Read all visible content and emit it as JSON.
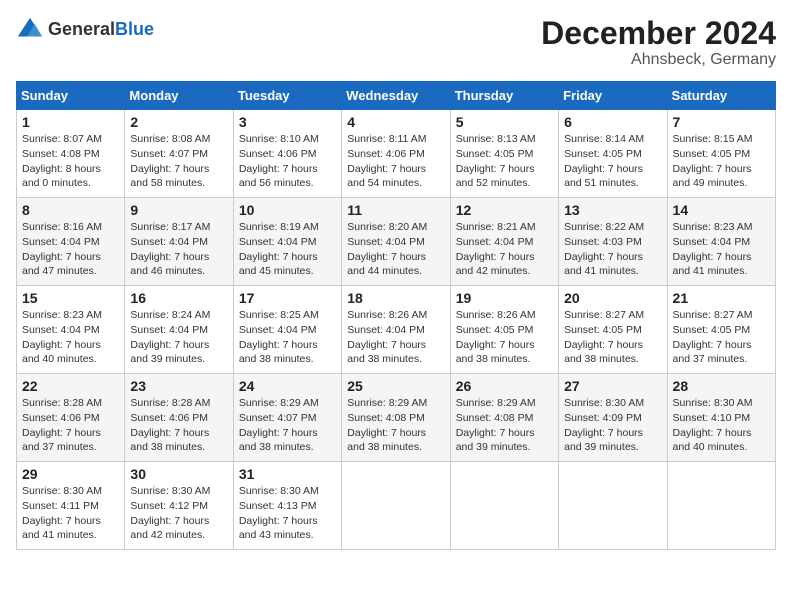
{
  "header": {
    "logo_general": "General",
    "logo_blue": "Blue",
    "month_title": "December 2024",
    "location": "Ahnsbeck, Germany"
  },
  "days_of_week": [
    "Sunday",
    "Monday",
    "Tuesday",
    "Wednesday",
    "Thursday",
    "Friday",
    "Saturday"
  ],
  "weeks": [
    [
      {
        "day": "1",
        "sunrise": "8:07 AM",
        "sunset": "4:08 PM",
        "daylight": "8 hours and 0 minutes."
      },
      {
        "day": "2",
        "sunrise": "8:08 AM",
        "sunset": "4:07 PM",
        "daylight": "7 hours and 58 minutes."
      },
      {
        "day": "3",
        "sunrise": "8:10 AM",
        "sunset": "4:06 PM",
        "daylight": "7 hours and 56 minutes."
      },
      {
        "day": "4",
        "sunrise": "8:11 AM",
        "sunset": "4:06 PM",
        "daylight": "7 hours and 54 minutes."
      },
      {
        "day": "5",
        "sunrise": "8:13 AM",
        "sunset": "4:05 PM",
        "daylight": "7 hours and 52 minutes."
      },
      {
        "day": "6",
        "sunrise": "8:14 AM",
        "sunset": "4:05 PM",
        "daylight": "7 hours and 51 minutes."
      },
      {
        "day": "7",
        "sunrise": "8:15 AM",
        "sunset": "4:05 PM",
        "daylight": "7 hours and 49 minutes."
      }
    ],
    [
      {
        "day": "8",
        "sunrise": "8:16 AM",
        "sunset": "4:04 PM",
        "daylight": "7 hours and 47 minutes."
      },
      {
        "day": "9",
        "sunrise": "8:17 AM",
        "sunset": "4:04 PM",
        "daylight": "7 hours and 46 minutes."
      },
      {
        "day": "10",
        "sunrise": "8:19 AM",
        "sunset": "4:04 PM",
        "daylight": "7 hours and 45 minutes."
      },
      {
        "day": "11",
        "sunrise": "8:20 AM",
        "sunset": "4:04 PM",
        "daylight": "7 hours and 44 minutes."
      },
      {
        "day": "12",
        "sunrise": "8:21 AM",
        "sunset": "4:04 PM",
        "daylight": "7 hours and 42 minutes."
      },
      {
        "day": "13",
        "sunrise": "8:22 AM",
        "sunset": "4:03 PM",
        "daylight": "7 hours and 41 minutes."
      },
      {
        "day": "14",
        "sunrise": "8:23 AM",
        "sunset": "4:04 PM",
        "daylight": "7 hours and 41 minutes."
      }
    ],
    [
      {
        "day": "15",
        "sunrise": "8:23 AM",
        "sunset": "4:04 PM",
        "daylight": "7 hours and 40 minutes."
      },
      {
        "day": "16",
        "sunrise": "8:24 AM",
        "sunset": "4:04 PM",
        "daylight": "7 hours and 39 minutes."
      },
      {
        "day": "17",
        "sunrise": "8:25 AM",
        "sunset": "4:04 PM",
        "daylight": "7 hours and 38 minutes."
      },
      {
        "day": "18",
        "sunrise": "8:26 AM",
        "sunset": "4:04 PM",
        "daylight": "7 hours and 38 minutes."
      },
      {
        "day": "19",
        "sunrise": "8:26 AM",
        "sunset": "4:05 PM",
        "daylight": "7 hours and 38 minutes."
      },
      {
        "day": "20",
        "sunrise": "8:27 AM",
        "sunset": "4:05 PM",
        "daylight": "7 hours and 38 minutes."
      },
      {
        "day": "21",
        "sunrise": "8:27 AM",
        "sunset": "4:05 PM",
        "daylight": "7 hours and 37 minutes."
      }
    ],
    [
      {
        "day": "22",
        "sunrise": "8:28 AM",
        "sunset": "4:06 PM",
        "daylight": "7 hours and 37 minutes."
      },
      {
        "day": "23",
        "sunrise": "8:28 AM",
        "sunset": "4:06 PM",
        "daylight": "7 hours and 38 minutes."
      },
      {
        "day": "24",
        "sunrise": "8:29 AM",
        "sunset": "4:07 PM",
        "daylight": "7 hours and 38 minutes."
      },
      {
        "day": "25",
        "sunrise": "8:29 AM",
        "sunset": "4:08 PM",
        "daylight": "7 hours and 38 minutes."
      },
      {
        "day": "26",
        "sunrise": "8:29 AM",
        "sunset": "4:08 PM",
        "daylight": "7 hours and 39 minutes."
      },
      {
        "day": "27",
        "sunrise": "8:30 AM",
        "sunset": "4:09 PM",
        "daylight": "7 hours and 39 minutes."
      },
      {
        "day": "28",
        "sunrise": "8:30 AM",
        "sunset": "4:10 PM",
        "daylight": "7 hours and 40 minutes."
      }
    ],
    [
      {
        "day": "29",
        "sunrise": "8:30 AM",
        "sunset": "4:11 PM",
        "daylight": "7 hours and 41 minutes."
      },
      {
        "day": "30",
        "sunrise": "8:30 AM",
        "sunset": "4:12 PM",
        "daylight": "7 hours and 42 minutes."
      },
      {
        "day": "31",
        "sunrise": "8:30 AM",
        "sunset": "4:13 PM",
        "daylight": "7 hours and 43 minutes."
      },
      null,
      null,
      null,
      null
    ]
  ],
  "labels": {
    "sunrise": "Sunrise: ",
    "sunset": "Sunset: ",
    "daylight": "Daylight: "
  }
}
